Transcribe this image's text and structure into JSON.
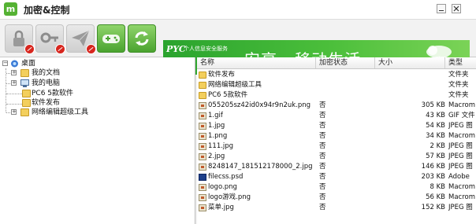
{
  "window": {
    "title": "加密&控制",
    "app_icon_glyph": "m"
  },
  "toolbar": {
    "buttons": [
      {
        "name": "encrypt-lock",
        "icon": "lock-icon",
        "disabled": true
      },
      {
        "name": "key",
        "icon": "key-icon",
        "disabled": true
      },
      {
        "name": "send",
        "icon": "paper-plane-icon",
        "disabled": true
      },
      {
        "name": "game-control",
        "icon": "gamepad-icon",
        "disabled": false
      },
      {
        "name": "sync",
        "icon": "refresh-icon",
        "disabled": false
      }
    ]
  },
  "banner": {
    "logo": "PYC",
    "tagline": "个人信息安全服务",
    "slogan": "安享 · 移动生活"
  },
  "tree": {
    "root": "桌面",
    "items": [
      {
        "label": "我的文档",
        "expandable": true
      },
      {
        "label": "我的电脑",
        "expandable": true
      },
      {
        "label": "PC6 5款软件",
        "expandable": false
      },
      {
        "label": "软件发布",
        "expandable": false
      },
      {
        "label": "网络编辑超级工具",
        "expandable": true
      }
    ]
  },
  "list": {
    "columns": {
      "name": "名称",
      "state": "加密状态",
      "size": "大小",
      "type": "类型"
    },
    "rows": [
      {
        "name": "软件发布",
        "state": "",
        "size": "",
        "type": "文件夹",
        "kind": "folder"
      },
      {
        "name": "网络编辑超级工具",
        "state": "",
        "size": "",
        "type": "文件夹",
        "kind": "folder"
      },
      {
        "name": "PC6 5款软件",
        "state": "",
        "size": "",
        "type": "文件夹",
        "kind": "folder"
      },
      {
        "name": "055205sz42id0x94r9n2uk.png",
        "state": "否",
        "size": "305 KB",
        "type": "Macrom",
        "kind": "image"
      },
      {
        "name": "1.gif",
        "state": "否",
        "size": "43 KB",
        "type": "GIF 文件",
        "kind": "image"
      },
      {
        "name": "1.jpg",
        "state": "否",
        "size": "54 KB",
        "type": "JPEG 图",
        "kind": "image"
      },
      {
        "name": "1.png",
        "state": "否",
        "size": "34 KB",
        "type": "Macrom",
        "kind": "image"
      },
      {
        "name": "111.jpg",
        "state": "否",
        "size": "2 KB",
        "type": "JPEG 图",
        "kind": "image"
      },
      {
        "name": "2.jpg",
        "state": "否",
        "size": "57 KB",
        "type": "JPEG 图",
        "kind": "image"
      },
      {
        "name": "8248147_181512178000_2.jpg",
        "state": "否",
        "size": "146 KB",
        "type": "JPEG 图",
        "kind": "image"
      },
      {
        "name": "filecss.psd",
        "state": "否",
        "size": "203 KB",
        "type": "Adobe",
        "kind": "psd"
      },
      {
        "name": "logo.png",
        "state": "否",
        "size": "8 KB",
        "type": "Macrom",
        "kind": "image"
      },
      {
        "name": "logo游戏.png",
        "state": "否",
        "size": "56 KB",
        "type": "Macrom",
        "kind": "image"
      },
      {
        "name": "菜单.jpg",
        "state": "否",
        "size": "152 KB",
        "type": "JPEG 图",
        "kind": "image"
      }
    ]
  }
}
